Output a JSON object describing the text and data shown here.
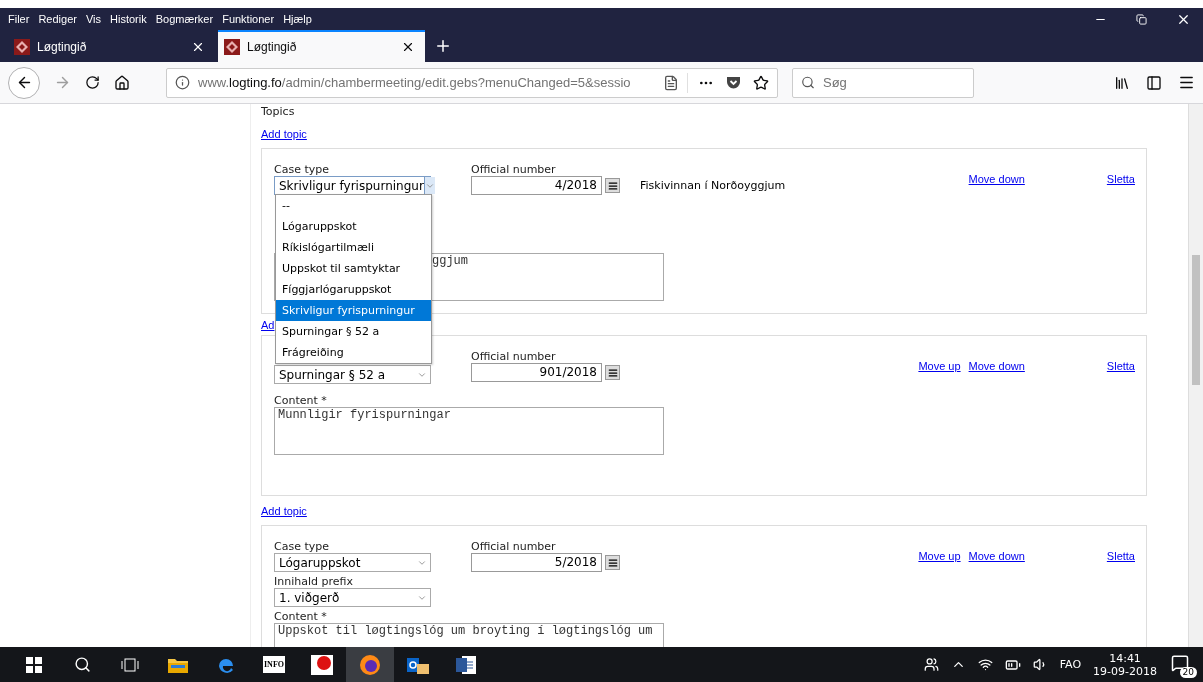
{
  "menu_bar": [
    "Filer",
    "Rediger",
    "Vis",
    "Historik",
    "Bogmærker",
    "Funktioner",
    "Hjælp"
  ],
  "tabs": [
    {
      "title": "Løgtingið",
      "selected": false
    },
    {
      "title": "Løgtingið",
      "selected": true
    }
  ],
  "address_bar": {
    "url": "www.**logting.fo**/admin/chambermeeting/edit.gebs?menuChanged=5&sessio"
  },
  "search": {
    "placeholder": "Søg"
  },
  "page": {
    "section_title": "Topics",
    "add_topic": "Add topic",
    "topics": [
      {
        "case_type_label": "Case type",
        "case_type": "Skrivligur fyrispurningur",
        "expanded": true,
        "options": [
          {
            "label": "--",
            "selected": false
          },
          {
            "label": "Lógaruppskot",
            "selected": false
          },
          {
            "label": "Ríkislógartilmæli",
            "selected": false
          },
          {
            "label": "Uppskot til samtyktar",
            "selected": false
          },
          {
            "label": "Fíggjarlógaruppskot",
            "selected": false
          },
          {
            "label": "Skrivligur fyrispurningur",
            "selected": true
          },
          {
            "label": "Spurningar § 52 a",
            "selected": false
          },
          {
            "label": "Frágreiðing",
            "selected": false
          }
        ],
        "number_label": "Official number",
        "number": "4/2018",
        "title": "Fiskivinnan í Norðoyggjum",
        "content": "ggjum",
        "links": [
          {
            "label": "Move down",
            "kind": "move"
          },
          {
            "label": "Sletta",
            "kind": "delete"
          }
        ],
        "after_link": "Ad"
      },
      {
        "case_type": "Spurningar § 52 a",
        "expanded": false,
        "number_label": "Official number",
        "number": "901/2018",
        "content_label": "Content *",
        "content": "Munnligir fyrispurningar",
        "links": [
          {
            "label": "Move up",
            "kind": "move"
          },
          {
            "label": "Move down",
            "kind": "move"
          },
          {
            "label": "Sletta",
            "kind": "delete"
          }
        ],
        "after_link": "Add topic"
      },
      {
        "case_type_label": "Case type",
        "case_type": "Lógaruppskot",
        "expanded": false,
        "number_label": "Official number",
        "number": "5/2018",
        "prefix_label": "Innihald prefix",
        "prefix": "1. viðgerð",
        "content_label": "Content *",
        "content": "Uppskot til løgtingslóg um broyting í løgtingslóg um",
        "links": [
          {
            "label": "Move up",
            "kind": "move"
          },
          {
            "label": "Move down",
            "kind": "move"
          },
          {
            "label": "Sletta",
            "kind": "delete"
          }
        ]
      }
    ]
  },
  "taskbar": {
    "info_app": "INFO",
    "language": "FAO",
    "time": "14:41",
    "date": "19-09-2018",
    "notifications": "20"
  }
}
